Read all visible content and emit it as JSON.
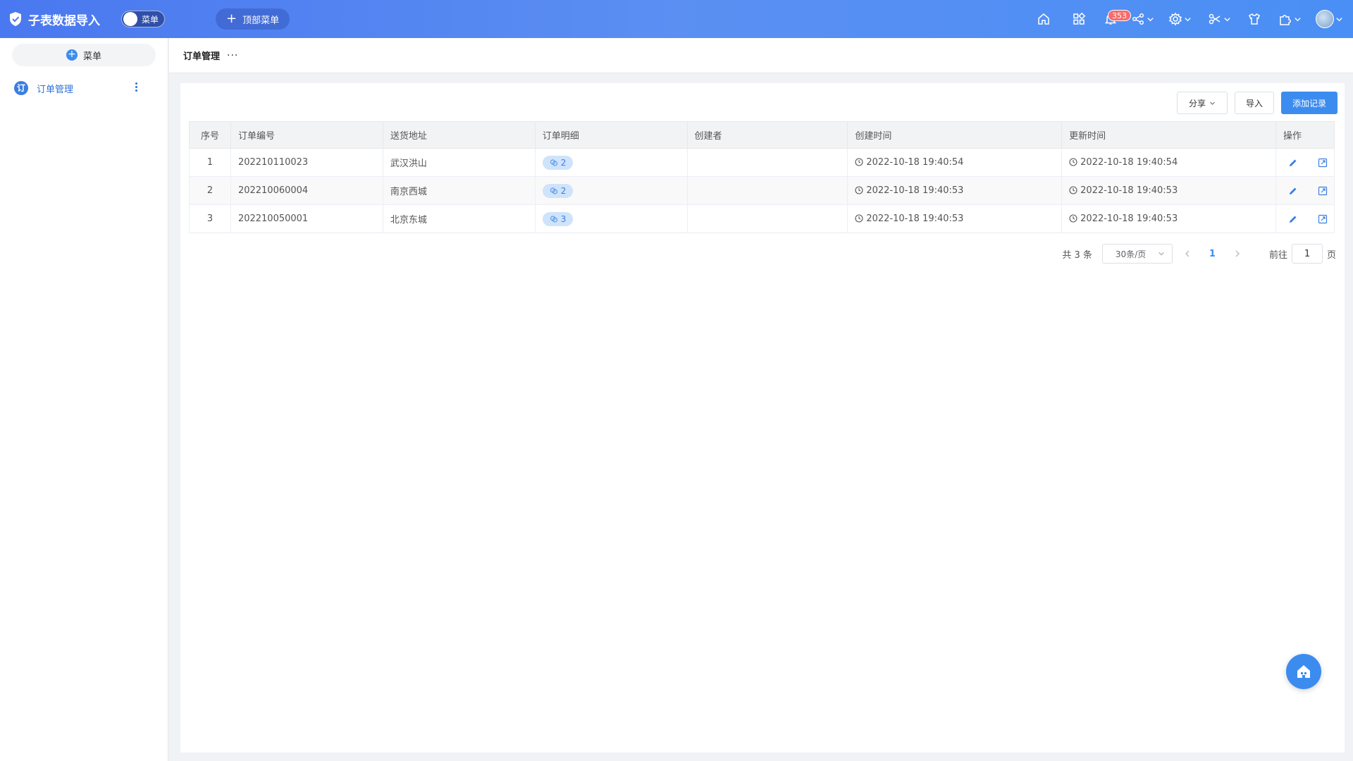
{
  "app": {
    "title": "子表数据导入"
  },
  "toggle": {
    "label": "菜单"
  },
  "topmenu": {
    "label": "顶部菜单"
  },
  "header_icons": {
    "notifications_badge": "353"
  },
  "sidebar": {
    "add_label": "菜单",
    "items": [
      {
        "label": "订单管理",
        "icon_text": "订"
      }
    ]
  },
  "breadcrumb": {
    "title": "订单管理",
    "more": "···"
  },
  "toolbar": {
    "share_label": "分享",
    "import_label": "导入",
    "add_label": "添加记录"
  },
  "table": {
    "headers": [
      "序号",
      "订单编号",
      "送货地址",
      "订单明细",
      "创建者",
      "创建时间",
      "更新时间",
      "操作"
    ],
    "rows": [
      {
        "index": "1",
        "order_no": "202210110023",
        "address": "武汉洪山",
        "detail_count": "2",
        "creator": "",
        "created": "2022-10-18 19:40:54",
        "updated": "2022-10-18 19:40:54"
      },
      {
        "index": "2",
        "order_no": "202210060004",
        "address": "南京西城",
        "detail_count": "2",
        "creator": "",
        "created": "2022-10-18 19:40:53",
        "updated": "2022-10-18 19:40:53"
      },
      {
        "index": "3",
        "order_no": "202210050001",
        "address": "北京东城",
        "detail_count": "3",
        "creator": "",
        "created": "2022-10-18 19:40:53",
        "updated": "2022-10-18 19:40:53"
      }
    ]
  },
  "pager": {
    "total": "共 3 条",
    "page_size": "30条/页",
    "current": "1",
    "goto_label": "前往",
    "goto_value": "1",
    "page_unit": "页"
  },
  "colors": {
    "accent": "#3c8cf0",
    "header_gradient_start": "#4a78f0",
    "header_gradient_end": "#4a8ff5",
    "badge": "#f56c6c"
  }
}
